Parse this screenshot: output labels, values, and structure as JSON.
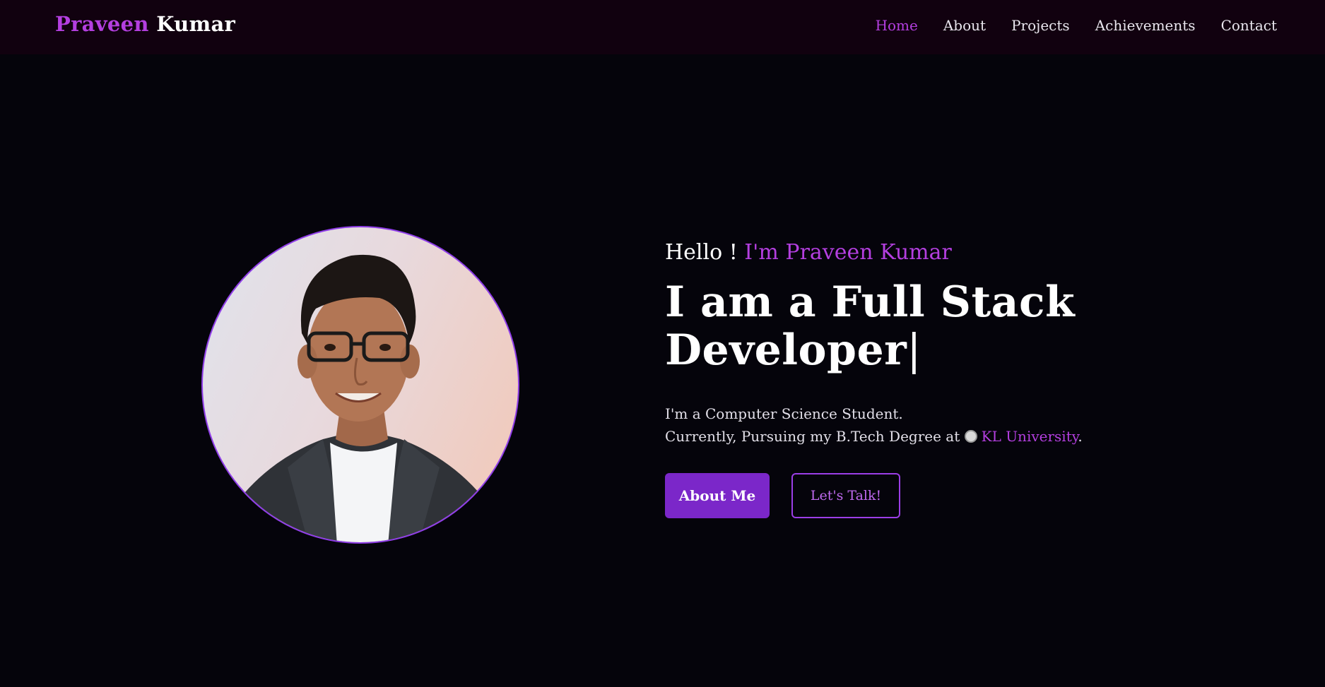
{
  "brand": {
    "first": "Praveen",
    "last": "Kumar"
  },
  "nav": {
    "items": [
      {
        "label": "Home",
        "active": true
      },
      {
        "label": "About"
      },
      {
        "label": "Projects"
      },
      {
        "label": "Achievements"
      },
      {
        "label": "Contact"
      }
    ]
  },
  "hero": {
    "hello_prefix": "Hello ! ",
    "hello_name": "I'm Praveen Kumar",
    "headline_line1": "I am a Full Stack",
    "headline_line2": "Developer",
    "cursor": "|",
    "desc_line1": "I'm a Computer Science Student.",
    "desc_line2_prefix": "Currently, Pursuing my B.Tech Degree at",
    "university": "KL University",
    "desc_line2_suffix": "."
  },
  "buttons": {
    "primary": "About Me",
    "secondary": "Let's Talk!"
  },
  "colors": {
    "accent": "#b43fe0",
    "button": "#7b27c9",
    "background": "#05040b",
    "navbar": "#11010f"
  }
}
